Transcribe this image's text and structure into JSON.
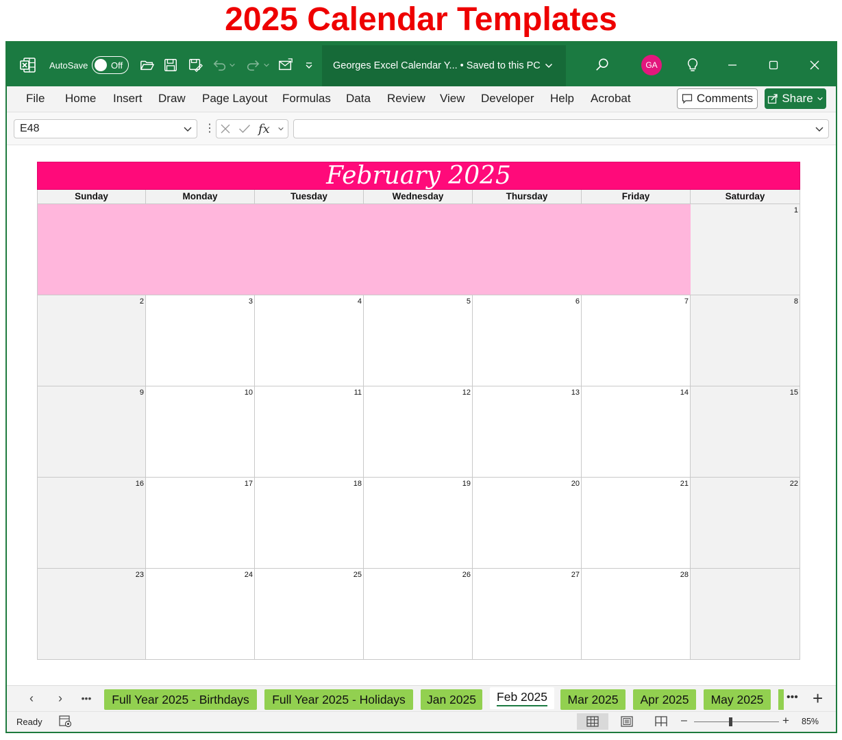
{
  "page_title": "2025 Calendar Templates",
  "titlebar": {
    "autosave_label": "AutoSave",
    "autosave_state": "Off",
    "doc_title": "Georges Excel Calendar Y...  •  Saved to this PC",
    "avatar_initials": "GA"
  },
  "menu": {
    "items": [
      "File",
      "Home",
      "Insert",
      "Draw",
      "Page Layout",
      "Formulas",
      "Data",
      "Review",
      "View",
      "Developer",
      "Help",
      "Acrobat"
    ],
    "comments_label": "Comments",
    "share_label": "Share"
  },
  "formula_bar": {
    "name_box": "E48",
    "fx_label": "fx",
    "formula": ""
  },
  "calendar": {
    "title": "February 2025",
    "weekdays": [
      "Sunday",
      "Monday",
      "Tuesday",
      "Wednesday",
      "Thursday",
      "Friday",
      "Saturday"
    ],
    "weeks": [
      [
        "",
        "",
        "",
        "",
        "",
        "",
        "1"
      ],
      [
        "2",
        "3",
        "4",
        "5",
        "6",
        "7",
        "8"
      ],
      [
        "9",
        "10",
        "11",
        "12",
        "13",
        "14",
        "15"
      ],
      [
        "16",
        "17",
        "18",
        "19",
        "20",
        "21",
        "22"
      ],
      [
        "23",
        "24",
        "25",
        "26",
        "27",
        "28",
        ""
      ]
    ],
    "header_color": "#ff0a7a",
    "blank_color": "#ffb6dc"
  },
  "sheet_tabs": {
    "tabs": [
      "Full Year 2025 - Birthdays",
      "Full Year 2025 - Holidays",
      "Jan 2025",
      "Feb 2025",
      "Mar 2025",
      "Apr 2025",
      "May 2025"
    ],
    "active": "Feb 2025",
    "more_label": "•••",
    "add_label": "+"
  },
  "status": {
    "ready": "Ready",
    "zoom": "85%"
  },
  "colors": {
    "excel_green": "#1b7a41",
    "tab_green": "#92d050",
    "title_red": "#ee0000"
  },
  "icons": [
    "excel-logo-icon",
    "open-folder-icon",
    "save-icon",
    "save-as-icon",
    "undo-icon",
    "redo-icon",
    "send-icon",
    "customize-qat-icon",
    "search-icon",
    "lightbulb-icon",
    "minimize-icon",
    "maximize-icon",
    "close-icon",
    "comment-icon",
    "share-icon",
    "cancel-icon",
    "enter-icon",
    "accessibility-icon",
    "normal-view-icon",
    "page-layout-view-icon",
    "page-break-view-icon"
  ]
}
